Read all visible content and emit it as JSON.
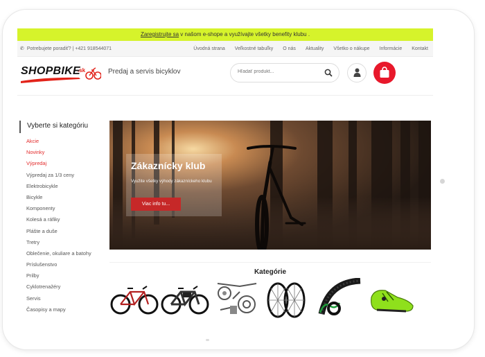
{
  "promo": {
    "link": "Zaregistrujte sa",
    "text": " v našom e-shope a využívajte všetky benefity klubu ."
  },
  "topbar": {
    "help_text": "Potrebujete poradiť? | +421 918544071",
    "nav": [
      "Úvodná strana",
      "Veľkostné tabuľky",
      "O nás",
      "Aktuality",
      "Všetko o nákupe",
      "Informácie",
      "Kontakt"
    ]
  },
  "header": {
    "logo_text": "SHOPBIKE",
    "logo_suffix": ".sk",
    "tagline": "Predaj a servis bicyklov",
    "search_placeholder": "Hľadať produkt..."
  },
  "sidebar": {
    "heading": "Vyberte si kategóriu",
    "items": [
      {
        "label": "Akcie",
        "highlight": true
      },
      {
        "label": "Novinky",
        "highlight": true
      },
      {
        "label": "Výpredaj",
        "highlight": true
      },
      {
        "label": "Výpredaj za 1/3 ceny",
        "highlight": false
      },
      {
        "label": "Elektrobicykle",
        "highlight": false
      },
      {
        "label": "Bicykle",
        "highlight": false
      },
      {
        "label": "Komponenty",
        "highlight": false
      },
      {
        "label": "Kolesá a ráfiky",
        "highlight": false
      },
      {
        "label": "Plášte a duše",
        "highlight": false
      },
      {
        "label": "Tretry",
        "highlight": false
      },
      {
        "label": "Oblečenie, okuliare a batohy",
        "highlight": false
      },
      {
        "label": "Príslušenstvo",
        "highlight": false
      },
      {
        "label": "Prilby",
        "highlight": false
      },
      {
        "label": "Cyklotrenažéry",
        "highlight": false
      },
      {
        "label": "Servis",
        "highlight": false
      },
      {
        "label": "Časopisy a mapy",
        "highlight": false
      }
    ]
  },
  "hero": {
    "title": "Zákaznícky klub",
    "text": "Využite všetky výhody zákazníckeho klubu",
    "button": "Viac info tu..."
  },
  "categories": {
    "title": "Kategórie",
    "icons": [
      "mountain-bike-icon",
      "e-bike-icon",
      "components-icon",
      "wheels-icon",
      "tires-icon",
      "cycling-shoe-icon"
    ]
  },
  "colors": {
    "accent_yellow": "#d6f32b",
    "brand_red": "#e8182b",
    "highlight_red": "#e32b2b"
  }
}
